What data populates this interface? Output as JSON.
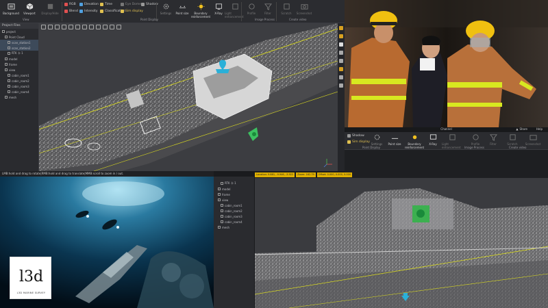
{
  "toolbar": {
    "buttons": [
      {
        "label": "Background",
        "icon": "background-icon"
      },
      {
        "label": "Viewport",
        "icon": "cube-icon"
      },
      {
        "label": "Display/Hide",
        "icon": "display-hide-icon"
      }
    ],
    "checks": [
      {
        "label": "RGB",
        "color": "#e05050"
      },
      {
        "label": "Elevation",
        "color": "#50a0e0"
      },
      {
        "label": "Time",
        "color": "#e0c050"
      },
      {
        "label": "Eye Dome",
        "color": "#a0a0a0"
      },
      {
        "label": "Shadow",
        "color": "#a0a0a0"
      },
      {
        "label": "Blend",
        "color": "#e05050"
      },
      {
        "label": "Intensity",
        "color": "#50a0e0"
      },
      {
        "label": "Classification",
        "color": "#e0c050"
      },
      {
        "label": "Sim display",
        "color": "#e0c050"
      }
    ],
    "tools": [
      {
        "label": "Settings",
        "icon": "gear-icon"
      },
      {
        "label": "Point size",
        "icon": "point-size-icon"
      },
      {
        "label": "Boundary reinforcement",
        "icon": "sun-icon"
      },
      {
        "label": "X-Ray",
        "icon": "xray-icon"
      },
      {
        "label": "Light enhancement",
        "icon": "light-icon"
      },
      {
        "label": "Profile",
        "icon": "profile-icon"
      },
      {
        "label": "Filter",
        "icon": "filter-icon"
      },
      {
        "label": "Scratch",
        "icon": "scratch-icon"
      },
      {
        "label": "Screenshot",
        "icon": "camera-icon"
      }
    ],
    "sections": {
      "view": "View",
      "point_display": "Point Display",
      "image_process": "Image Process",
      "create_video": "Create video"
    }
  },
  "sidebar": {
    "title": "Project Files",
    "items": [
      "project",
      "Point Cloud",
      "scan_station1",
      "scan_station2",
      "RTK 卡 1",
      "model",
      "frame",
      "view",
      "cabin_room1",
      "cabin_room2",
      "cabin_room3",
      "cabin_room4",
      "mesh"
    ]
  },
  "status_bar": {
    "text": "LMB:hold and drag to rotate|RMB:hold and drag to translate|MMB:scroll to zoom in / out."
  },
  "ui2": {
    "window_title": "Channel",
    "share_label": "Share",
    "help_label": "Help",
    "checks": [
      "Shadow",
      "Sim display"
    ],
    "tools": [
      "Settings",
      "Point size",
      "Boundary reinforcement",
      "X-Ray",
      "Light enhancement",
      "Profile",
      "Filter",
      "Scratch",
      "Screenshot"
    ],
    "sections": {
      "point_display": "Point Display",
      "image_process": "Image Process",
      "create_video": "Create video"
    },
    "panel_items": [
      "RTK 卡 1",
      "model",
      "frame",
      "view",
      "cabin_room1",
      "cabin_room2",
      "cabin_room3",
      "cabin_room4",
      "mesh"
    ],
    "coords": [
      "Location: 9.881, -9.946, -3.922",
      "Zoom: 162.79",
      "Offset: 0.000, 0.000, 0.000"
    ]
  },
  "logo": {
    "mark": "l3d",
    "sub": "L3D MARINE SURVEY"
  }
}
